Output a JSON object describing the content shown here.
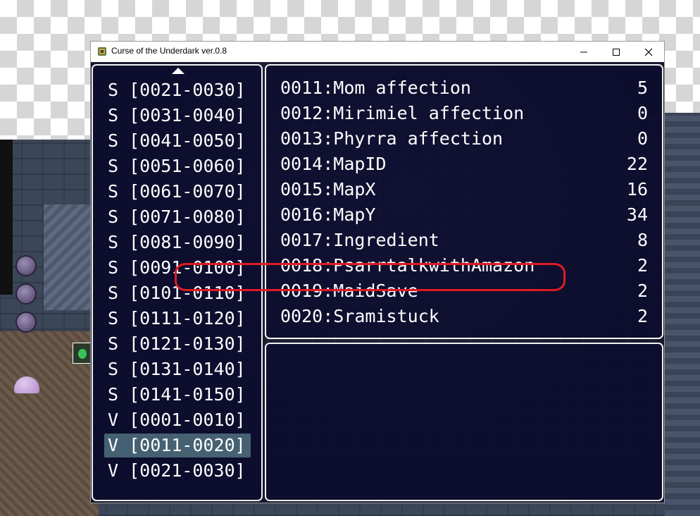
{
  "window": {
    "title": "Curse of the Underdark ver.0.8",
    "minimize_glyph": "—",
    "maximize_glyph": "☐",
    "close_glyph": "✕"
  },
  "categories": [
    {
      "type": "S",
      "range": "[0021-0030]"
    },
    {
      "type": "S",
      "range": "[0031-0040]"
    },
    {
      "type": "S",
      "range": "[0041-0050]"
    },
    {
      "type": "S",
      "range": "[0051-0060]"
    },
    {
      "type": "S",
      "range": "[0061-0070]"
    },
    {
      "type": "S",
      "range": "[0071-0080]"
    },
    {
      "type": "S",
      "range": "[0081-0090]"
    },
    {
      "type": "S",
      "range": "[0091-0100]"
    },
    {
      "type": "S",
      "range": "[0101-0110]"
    },
    {
      "type": "S",
      "range": "[0111-0120]"
    },
    {
      "type": "S",
      "range": "[0121-0130]"
    },
    {
      "type": "S",
      "range": "[0131-0140]"
    },
    {
      "type": "S",
      "range": "[0141-0150]"
    },
    {
      "type": "V",
      "range": "[0001-0010]"
    },
    {
      "type": "V",
      "range": "[0011-0020]",
      "selected": true
    },
    {
      "type": "V",
      "range": "[0021-0030]"
    }
  ],
  "variables": [
    {
      "id": "0011",
      "name": "Mom affection",
      "value": "5"
    },
    {
      "id": "0012",
      "name": "Mirimiel affection",
      "value": "0"
    },
    {
      "id": "0013",
      "name": "Phyrra affection",
      "value": "0"
    },
    {
      "id": "0014",
      "name": "MapID",
      "value": "22"
    },
    {
      "id": "0015",
      "name": "MapX",
      "value": "16"
    },
    {
      "id": "0016",
      "name": "MapY",
      "value": "34"
    },
    {
      "id": "0017",
      "name": "Ingredient",
      "value": "8"
    },
    {
      "id": "0018",
      "name": "PsarrtalkwithAmazon",
      "value": "2"
    },
    {
      "id": "0019",
      "name": "MaidSave",
      "value": "2"
    },
    {
      "id": "0020",
      "name": "Sramistuck",
      "value": "2"
    }
  ],
  "colors": {
    "panel_border": "#f2f2f2",
    "panel_bg": "#0a0a2e",
    "selection": "#96d7d2",
    "annotation_ring": "#e01b24"
  }
}
